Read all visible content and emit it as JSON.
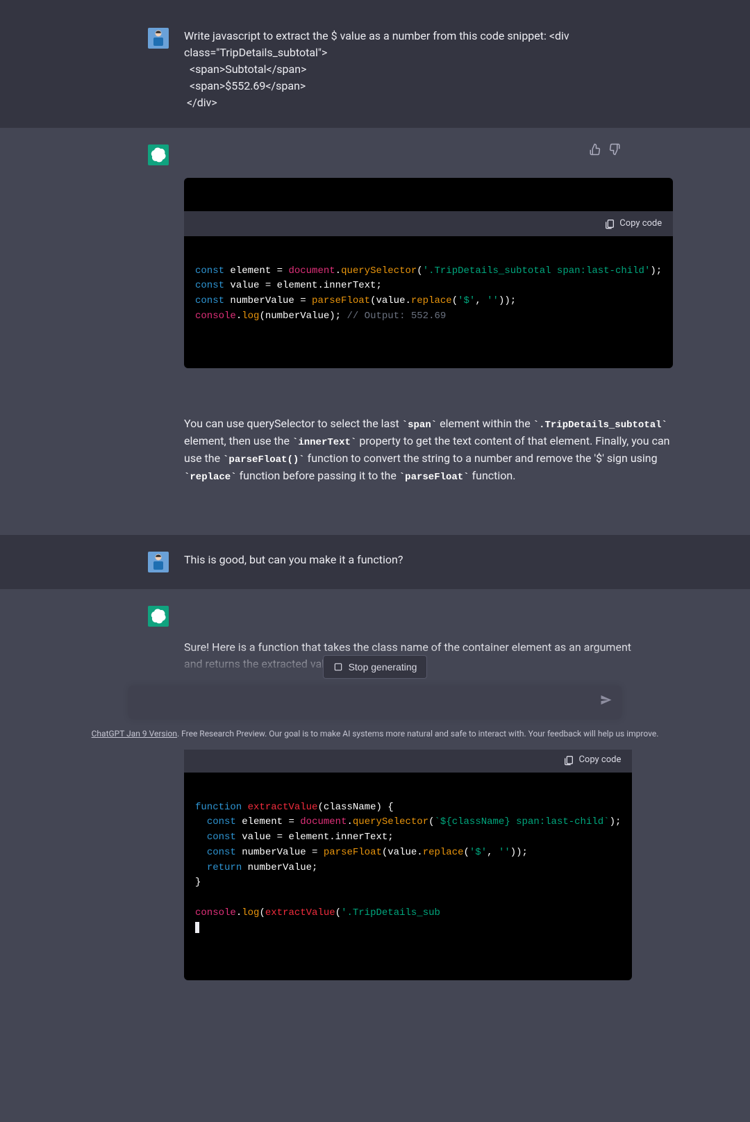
{
  "messages": {
    "user1": "Write javascript to extract the $ value as a number from this code snippet: <div class=\"TripDetails_subtotal\">\n  <span>Subtotal</span>\n  <span>$552.69</span>\n </div>",
    "user2": "This is good, but can you make it a function?",
    "assistant1_explain_pre": "You can use querySelector to select the last ",
    "assistant1_inline_span": "`span`",
    "assistant1_explain_2": " element within the ",
    "assistant1_inline_class": "`.TripDetails_subtotal`",
    "assistant1_explain_3": " element, then use the ",
    "assistant1_inline_innertext": "`innerText`",
    "assistant1_explain_4": " property to get the text content of that element. Finally, you can use the ",
    "assistant1_inline_parsefloat": "`parseFloat()`",
    "assistant1_explain_5": " function to convert the string to a number and remove the '$' sign using ",
    "assistant1_inline_replace": "`replace`",
    "assistant1_explain_6": " function before passing it to the ",
    "assistant1_inline_parsefloat2": "`parseFloat`",
    "assistant1_explain_7": " function.",
    "assistant2_intro": "Sure! Here is a function that takes the class name of the container element as an argument and returns the extracted value as a number:"
  },
  "code1": {
    "line1_kw": "const",
    "line1_var": " element ",
    "line1_op": "= ",
    "line1_obj": "document",
    "line1_dot": ".",
    "line1_fn": "querySelector",
    "line1_open": "(",
    "line1_str": "'.TripDetails_subtotal span:last-child'",
    "line1_close": ");",
    "line2_kw": "const",
    "line2_rest": " value = element.innerText;",
    "line3_kw": "const",
    "line3_var": " numberValue ",
    "line3_op": "= ",
    "line3_fn": "parseFloat",
    "line3_open": "(value.",
    "line3_fn2": "replace",
    "line3_args_open": "(",
    "line3_str1": "'$'",
    "line3_comma": ", ",
    "line3_str2": "''",
    "line3_close": "));",
    "line4_obj": "console",
    "line4_dot": ".",
    "line4_fn": "log",
    "line4_rest": "(numberValue); ",
    "line4_cmt": "// Output: 552.69"
  },
  "code2": {
    "l1_kw": "function",
    "l1_sp": " ",
    "l1_name": "extractValue",
    "l1_rest": "(className) {",
    "l2_ind": "  ",
    "l2_kw": "const",
    "l2_var": " element ",
    "l2_op": "= ",
    "l2_obj": "document",
    "l2_dot": ".",
    "l2_fn": "querySelector",
    "l2_open": "(",
    "l2_tick": "`${className} span:last-child`",
    "l2_close": ");",
    "l3_ind": "  ",
    "l3_kw": "const",
    "l3_rest": " value = element.innerText;",
    "l4_ind": "  ",
    "l4_kw": "const",
    "l4_var": " numberValue ",
    "l4_op": "= ",
    "l4_fn": "parseFloat",
    "l4_open": "(value.",
    "l4_fn2": "replace",
    "l4_args_open": "(",
    "l4_str1": "'$'",
    "l4_comma": ", ",
    "l4_str2": "''",
    "l4_close": "));",
    "l5_ind": "  ",
    "l5_kw": "return",
    "l5_rest": " numberValue;",
    "l6": "}",
    "l7": "",
    "l8_obj": "console",
    "l8_dot": ".",
    "l8_fn": "log",
    "l8_open": "(",
    "l8_name": "extractValue",
    "l8_open2": "(",
    "l8_str": "'.TripDetails_sub"
  },
  "ui": {
    "copy_code": "Copy code",
    "stop_generating": "Stop generating",
    "input_placeholder": "",
    "footer_link": "ChatGPT Jan 9 Version",
    "footer_rest": ". Free Research Preview. Our goal is to make AI systems more natural and safe to interact with. Your feedback will help us improve."
  }
}
